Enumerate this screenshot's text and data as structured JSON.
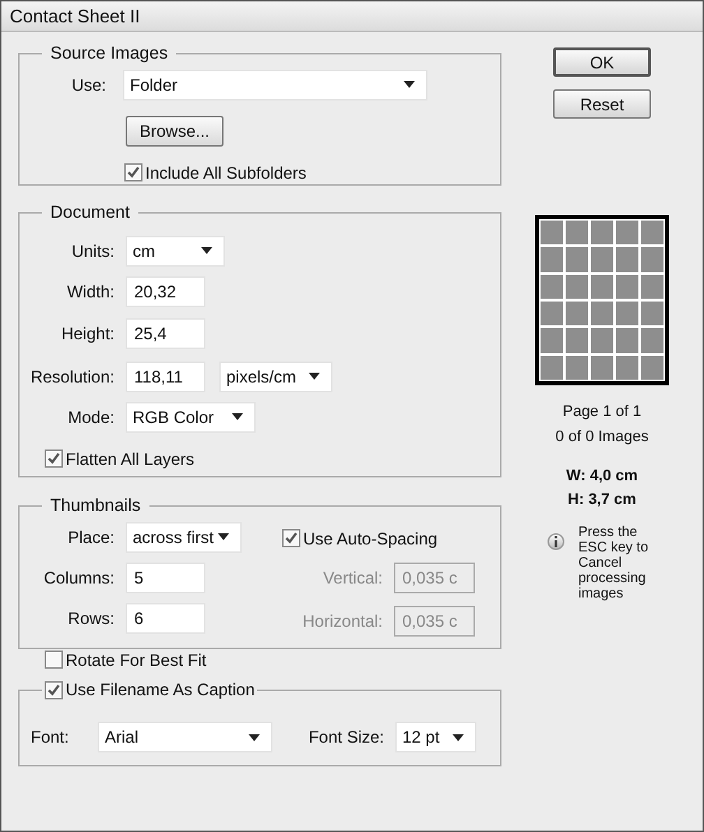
{
  "window": {
    "title": "Contact Sheet II"
  },
  "source_images": {
    "title": "Source Images",
    "use_label": "Use:",
    "use_value": "Folder",
    "browse_button": "Browse...",
    "include_subfolders": {
      "label": "Include All Subfolders",
      "checked": true
    }
  },
  "document": {
    "title": "Document",
    "units": {
      "label": "Units:",
      "value": "cm"
    },
    "width": {
      "label": "Width:",
      "value": "20,32"
    },
    "height": {
      "label": "Height:",
      "value": "25,4"
    },
    "resolution": {
      "label": "Resolution:",
      "value": "118,11",
      "unit": "pixels/cm"
    },
    "mode": {
      "label": "Mode:",
      "value": "RGB Color"
    },
    "flatten": {
      "label": "Flatten All Layers",
      "checked": true
    }
  },
  "thumbnails": {
    "title": "Thumbnails",
    "place": {
      "label": "Place:",
      "value": "across first"
    },
    "columns": {
      "label": "Columns:",
      "value": "5"
    },
    "rows": {
      "label": "Rows:",
      "value": "6"
    },
    "rotate": {
      "label": "Rotate For Best Fit",
      "checked": false
    },
    "auto_spacing": {
      "label": "Use Auto-Spacing",
      "checked": true
    },
    "vertical": {
      "label": "Vertical:",
      "value": "0,035 c",
      "disabled": true
    },
    "horizontal": {
      "label": "Horizontal:",
      "value": "0,035 c",
      "disabled": true
    }
  },
  "caption": {
    "label": "Use Filename As Caption",
    "checked": true,
    "font": {
      "label": "Font:",
      "value": "Arial"
    },
    "font_size": {
      "label": "Font Size:",
      "value": "12 pt"
    }
  },
  "buttons": [
    {
      "label": "OK",
      "default": true
    },
    {
      "label": "Reset",
      "default": false
    }
  ],
  "preview": {
    "page": "Page 1 of 1",
    "images": "0 of 0 Images",
    "w": "W: 4,0 cm",
    "h": "H: 3,7 cm",
    "note": "Press the ESC key to Cancel processing images"
  }
}
